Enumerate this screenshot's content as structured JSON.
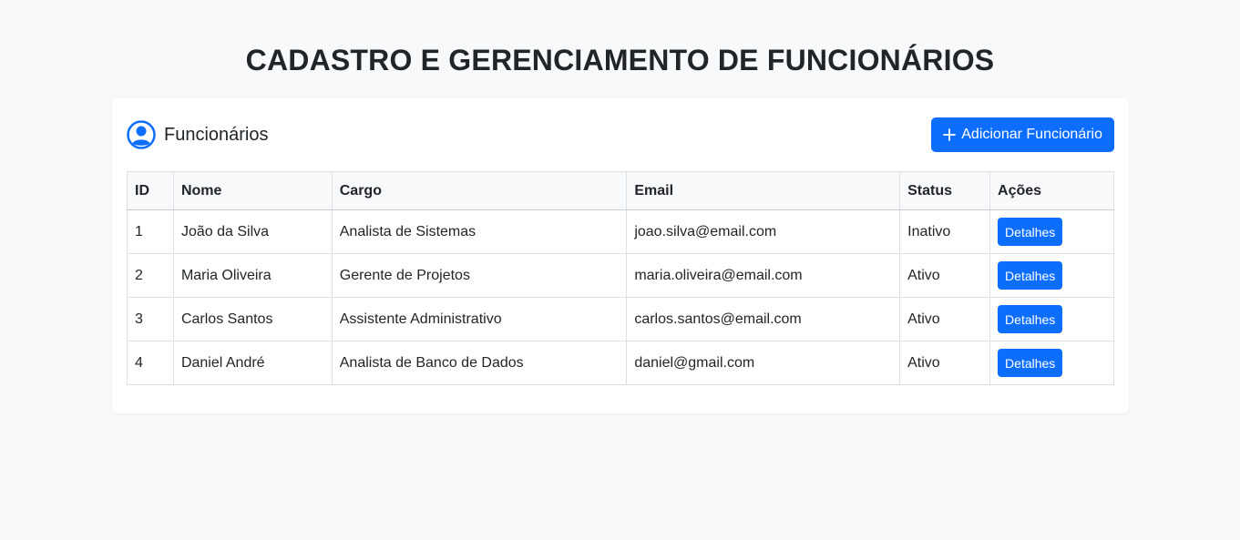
{
  "page": {
    "title": "CADASTRO E GERENCIAMENTO DE FUNCIONÁRIOS"
  },
  "card": {
    "title": "Funcionários",
    "icon": "user-circle-icon",
    "add_button_label": "Adicionar Funcionário",
    "add_button_icon": "plus-icon"
  },
  "colors": {
    "primary": "#0d6efd",
    "background": "#f8f9fa",
    "text": "#212529"
  },
  "table": {
    "headers": {
      "id": "ID",
      "nome": "Nome",
      "cargo": "Cargo",
      "email": "Email",
      "status": "Status",
      "acoes": "Ações"
    },
    "rows": [
      {
        "id": "1",
        "nome": "João da Silva",
        "cargo": "Analista de Sistemas",
        "email": "joao.silva@email.com",
        "status": "Inativo",
        "action_label": "Detalhes"
      },
      {
        "id": "2",
        "nome": "Maria Oliveira",
        "cargo": "Gerente de Projetos",
        "email": "maria.oliveira@email.com",
        "status": "Ativo",
        "action_label": "Detalhes"
      },
      {
        "id": "3",
        "nome": "Carlos Santos",
        "cargo": "Assistente Administrativo",
        "email": "carlos.santos@email.com",
        "status": "Ativo",
        "action_label": "Detalhes"
      },
      {
        "id": "4",
        "nome": "Daniel André",
        "cargo": "Analista de Banco de Dados",
        "email": "daniel@gmail.com",
        "status": "Ativo",
        "action_label": "Detalhes"
      }
    ]
  }
}
